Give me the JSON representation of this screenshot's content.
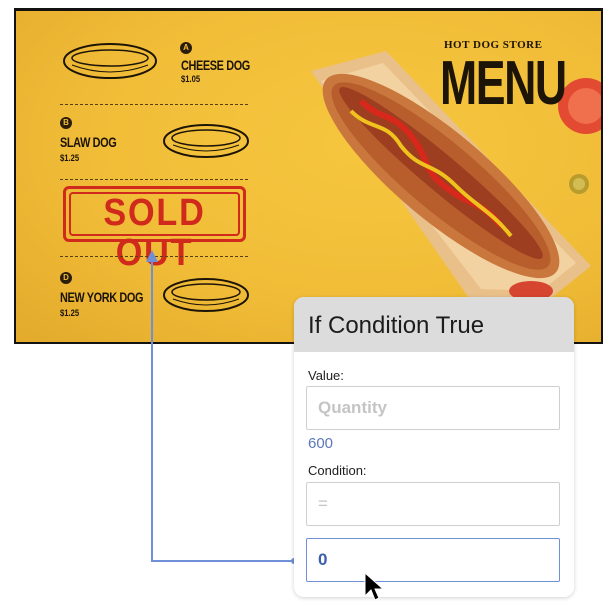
{
  "menu_board": {
    "brand": {
      "arc_text": "HOT DOG STORE",
      "title": "MENU"
    },
    "items": [
      {
        "badge": "A",
        "name": "CHEESE DOG",
        "price": "$1.05"
      },
      {
        "badge": "B",
        "name": "SLAW DOG",
        "price": "$1.25"
      },
      {
        "badge": "D",
        "name": "NEW YORK DOG",
        "price": "$1.25"
      }
    ],
    "sold_out": "SOLD OUT"
  },
  "dialog": {
    "title": "If Condition True",
    "value_label": "Value:",
    "value_placeholder": "Quantity",
    "value_hint": "600",
    "condition_label": "Condition:",
    "condition_placeholder": "=",
    "compare_value": "0"
  },
  "colors": {
    "board_yellow": "#f1bd38",
    "sold_out_red": "#cf2a1b",
    "connector_blue": "#6f8fd6",
    "dialog_header": "#dcdcdc"
  }
}
